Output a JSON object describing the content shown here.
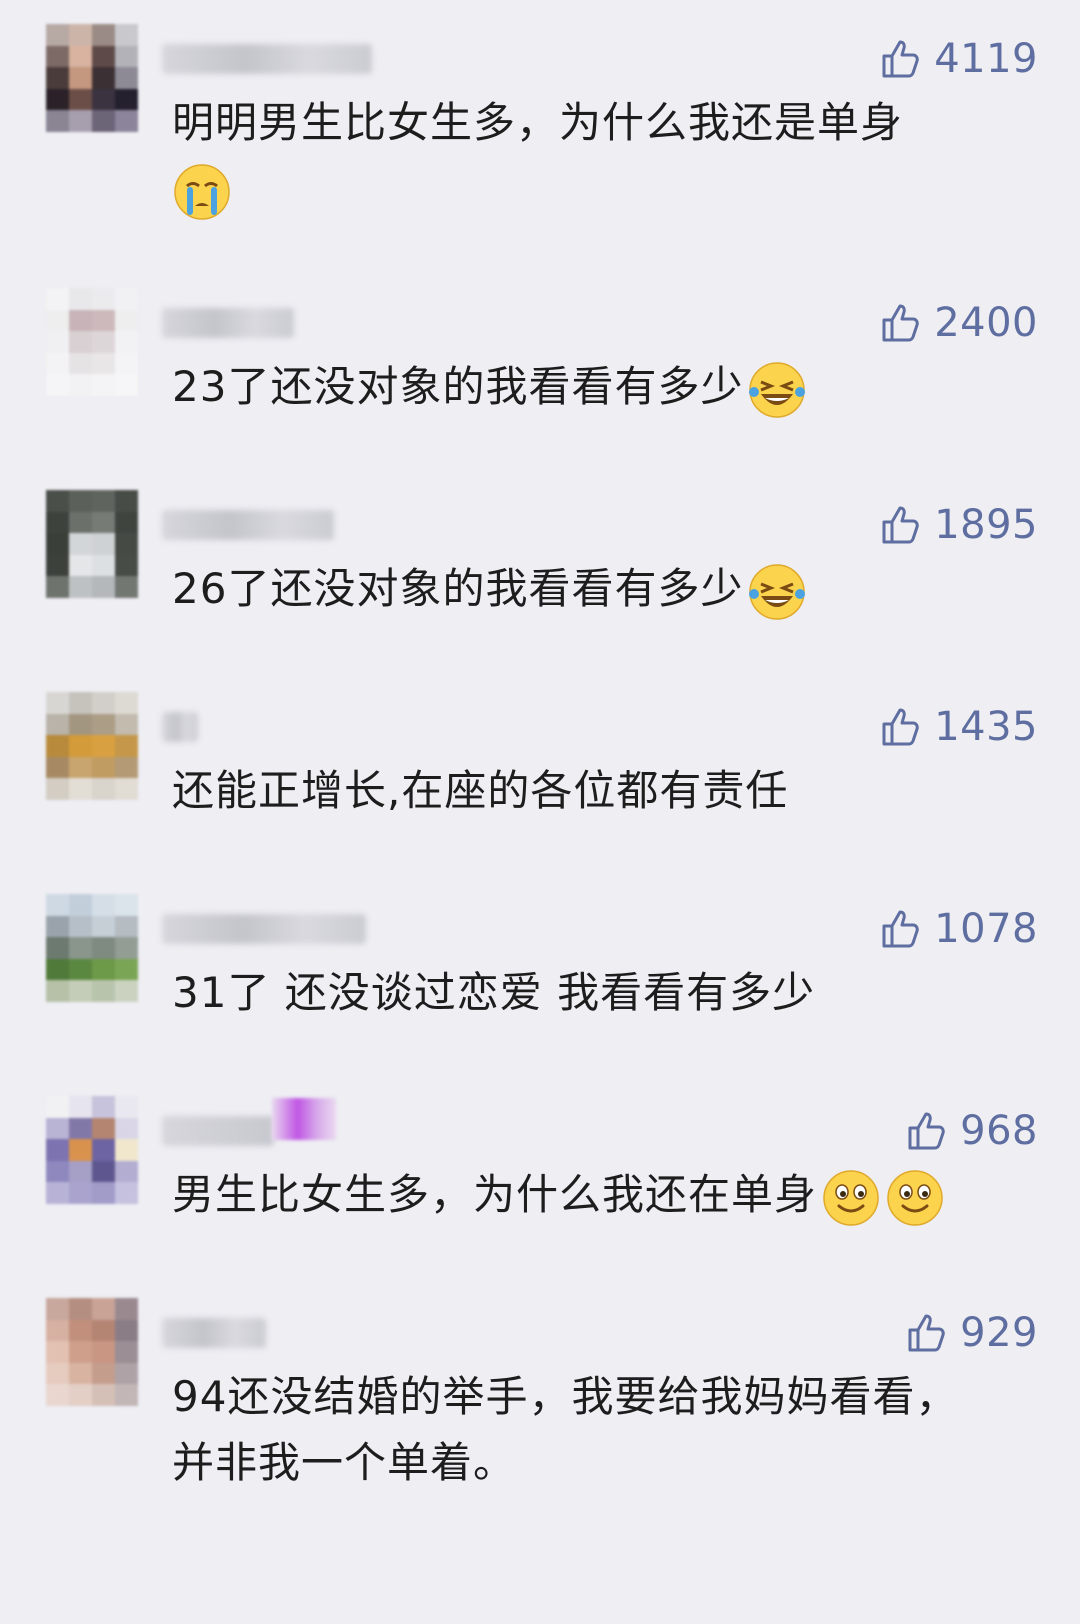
{
  "comments": [
    {
      "likes": "4119",
      "text": "明明男生比女生多，为什么我还是单身",
      "emojis": [
        "crying-face"
      ]
    },
    {
      "likes": "2400",
      "text": "23了还没对象的我看看有多少",
      "emojis": [
        "laughing-tears-face"
      ]
    },
    {
      "likes": "1895",
      "text": "26了还没对象的我看看有多少",
      "emojis": [
        "laughing-tears-face"
      ]
    },
    {
      "likes": "1435",
      "text": "还能正增长,在座的各位都有责任",
      "emojis": []
    },
    {
      "likes": "1078",
      "text": "31了 还没谈过恋爱 我看看有多少",
      "emojis": []
    },
    {
      "likes": "968",
      "text": "男生比女生多，为什么我还在单身",
      "emojis": [
        "smiling-face",
        "smiling-face"
      ]
    },
    {
      "likes": "929",
      "text": "94还没结婚的举手，我要给我妈妈看看，并非我一个单着。",
      "emojis": []
    }
  ],
  "colors": {
    "background": "#eeeef3",
    "like_accent": "#5f6ea0",
    "text": "#1d1d1d"
  }
}
